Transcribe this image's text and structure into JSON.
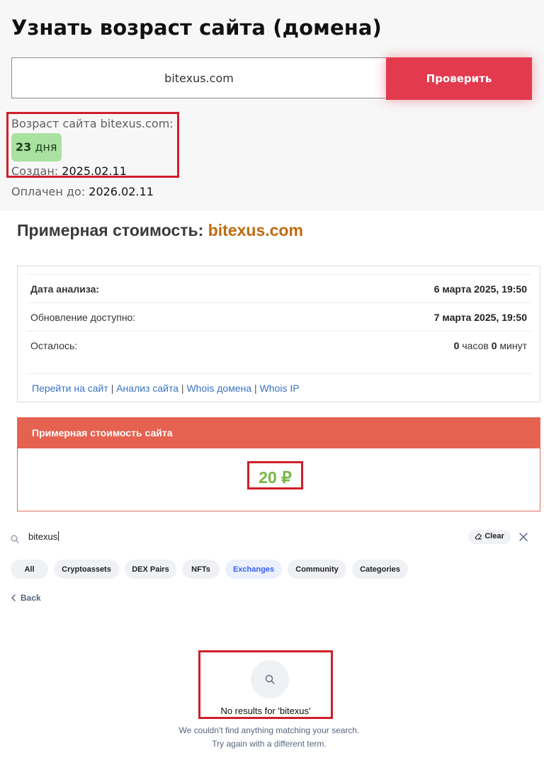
{
  "age_section": {
    "title": "Узнать возраст сайта (домена)",
    "domain_input_value": "bitexus.com",
    "check_button": "Проверить",
    "age_label": "Возраст сайта bitexus.com:",
    "age_number": "23",
    "age_unit": "дня",
    "created_label": "Создан:",
    "created_value": "2025.02.11",
    "paid_label": "Оплачен до:",
    "paid_value": "2026.02.11",
    "colors": {
      "button": "#e33a4e",
      "badge": "#a9e2a0",
      "highlight_border": "#d01f2a"
    }
  },
  "cost_section": {
    "title": "Примерная стоимость:",
    "domain": "bitexus.com",
    "rows": [
      {
        "label": "Дата анализа:",
        "value": "6 марта 2025, 19:50"
      },
      {
        "label": "Обновление доступно:",
        "value": "7 марта 2025, 19:50"
      },
      {
        "label": "Осталось:",
        "hours": "0",
        "hours_unit": "часов",
        "minutes": "0",
        "minutes_unit": "минут"
      }
    ],
    "links": [
      "Перейти на сайт",
      "Анализ сайта",
      "Whois домена",
      "Whois IP"
    ],
    "link_separator": "|",
    "price_header": "Примерная стоимость сайта",
    "price_value": "20 ₽",
    "colors": {
      "domain": "#c06a10",
      "header": "#e56150",
      "price": "#77b845",
      "link": "#3b72c4"
    }
  },
  "search_panel": {
    "query": "bitexus",
    "clear_label": "Clear",
    "chips": [
      "All",
      "Cryptoassets",
      "DEX Pairs",
      "NFTs",
      "Exchanges",
      "Community",
      "Categories"
    ],
    "active_chip": "Exchanges",
    "back_label": "Back",
    "no_results_title": "No results for 'bitexus'",
    "no_results_line1": "We couldn't find anything matching your search.",
    "no_results_line2": "Try again with a different term.",
    "icons": [
      "search-icon",
      "eraser-icon",
      "close-icon",
      "chevron-left-icon"
    ],
    "colors": {
      "chip_bg": "#eff1f4",
      "chip_active_text": "#3861fb",
      "muted_text": "#58667e"
    }
  }
}
